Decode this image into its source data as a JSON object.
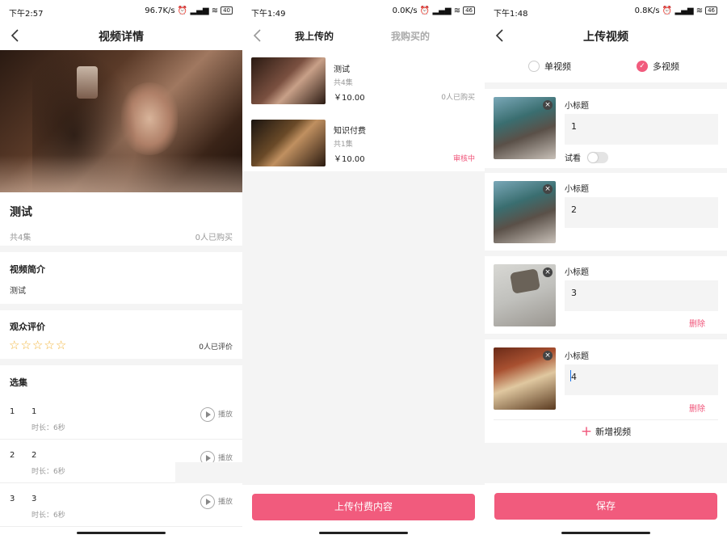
{
  "colors": {
    "accent": "#f15b7d",
    "audit": "#f0557a",
    "star": "#f2b53a"
  },
  "screen1": {
    "status": {
      "time": "下午2:57",
      "speed": "96.7K/s",
      "battery": "40"
    },
    "title": "视频详情",
    "video_title": "测试",
    "episode_count": "共4集",
    "purchased": "0人已购买",
    "intro_heading": "视频简介",
    "intro_text": "测试",
    "review_heading": "观众评价",
    "rating_stars": 0,
    "review_count": "0人已评价",
    "episodes_heading": "选集",
    "play_label": "播放",
    "episodes": [
      {
        "index": "1",
        "name": "1",
        "duration": "时长：6秒"
      },
      {
        "index": "2",
        "name": "2",
        "duration": "时长：6秒"
      },
      {
        "index": "3",
        "name": "3",
        "duration": "时长：6秒"
      }
    ]
  },
  "screen2": {
    "status": {
      "time": "下午1:49",
      "speed": "0.0K/s",
      "battery": "46"
    },
    "tabs": [
      "我上传的",
      "我购买的"
    ],
    "items": [
      {
        "title": "测试",
        "episodes": "共4集",
        "price": "￥10.00",
        "status": "0人已购买"
      },
      {
        "title": "知识付费",
        "episodes": "共1集",
        "price": "￥10.00",
        "status": "审核中"
      }
    ],
    "upload_button": "上传付费内容"
  },
  "screen3": {
    "status": {
      "time": "下午1:48",
      "speed": "0.8K/s",
      "battery": "46"
    },
    "title": "上传视频",
    "mode_single": "单视频",
    "mode_multi": "多视频",
    "selected_mode": "多视频",
    "subtitle_label": "小标题",
    "trial_label": "试看",
    "delete_label": "删除",
    "add_video": "新增视频",
    "save_button": "保存",
    "videos": [
      {
        "value": "1"
      },
      {
        "value": "2"
      },
      {
        "value": "3"
      },
      {
        "value": "4"
      }
    ]
  }
}
